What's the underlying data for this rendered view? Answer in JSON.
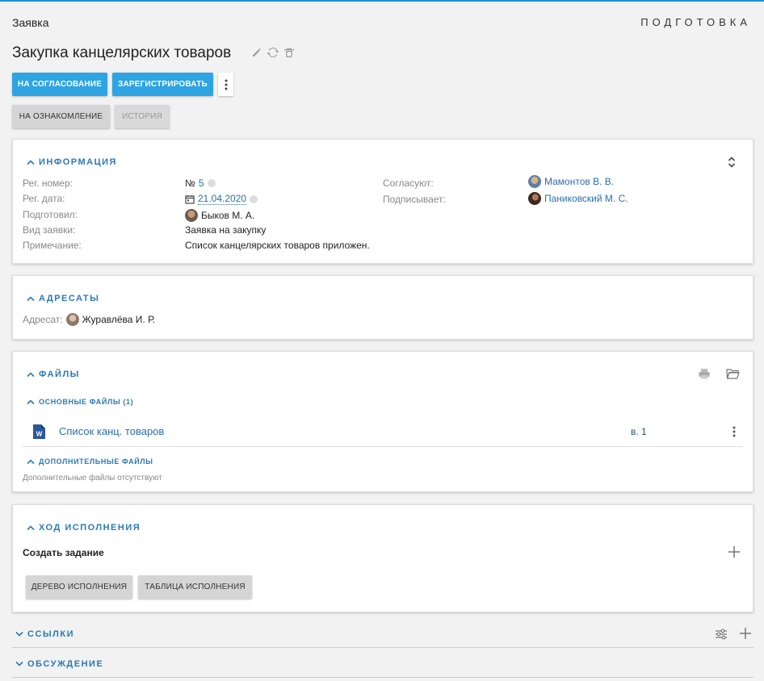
{
  "header": {
    "doc_type": "Заявка",
    "status": "ПОДГОТОВКА",
    "title": "Закупка канцелярских товаров",
    "icons": [
      "edit-icon",
      "refresh-icon",
      "trash-icon"
    ]
  },
  "actions": {
    "primary": [
      "НА СОГЛАСОВАНИЕ",
      "ЗАРЕГИСТРИРОВАТЬ"
    ],
    "secondary": [
      "НА ОЗНАКОМЛЕНИЕ",
      "ИСТОРИЯ"
    ]
  },
  "info": {
    "title": "ИНФОРМАЦИЯ",
    "reg_number_label": "Рег. номер:",
    "reg_number_prefix": "№",
    "reg_number": "5",
    "reg_date_label": "Рег. дата:",
    "reg_date": "21.04.2020",
    "prepared_label": "Подготовил:",
    "prepared": "Быков М. А.",
    "kind_label": "Вид заявки:",
    "kind": "Заявка на закупку",
    "note_label": "Примечание:",
    "note": "Список канцелярских товаров приложен.",
    "approvers_label": "Согласуют:",
    "approvers": "Мамонтов В. В.",
    "signer_label": "Подписывает:",
    "signer": "Паниковский М. С."
  },
  "recipients": {
    "title": "АДРЕСАТЫ",
    "label": "Адресат:",
    "name": "Журавлёва И. Р."
  },
  "files": {
    "title": "ФАЙЛЫ",
    "main_title": "ОСНОВНЫЕ ФАЙЛЫ (1)",
    "file_name": "Список канц. товаров",
    "file_version": "в. 1",
    "extra_title": "ДОПОЛНИТЕЛЬНЫЕ ФАЙЛЫ",
    "extra_empty": "Дополнительные файлы отсутствуют"
  },
  "execution": {
    "title": "ХОД ИСПОЛНЕНИЯ",
    "create_task": "Создать задание",
    "buttons": [
      "ДЕРЕВО ИСПОЛНЕНИЯ",
      "ТАБЛИЦА ИСПОЛНЕНИЯ"
    ]
  },
  "links": {
    "title": "ССЫЛКИ"
  },
  "discussion": {
    "title": "ОБСУЖДЕНИЕ"
  },
  "colors": {
    "accent": "#2ea4e3",
    "link": "#2a6fb0",
    "heading": "#2a7ab8",
    "word": "#2b579a"
  }
}
